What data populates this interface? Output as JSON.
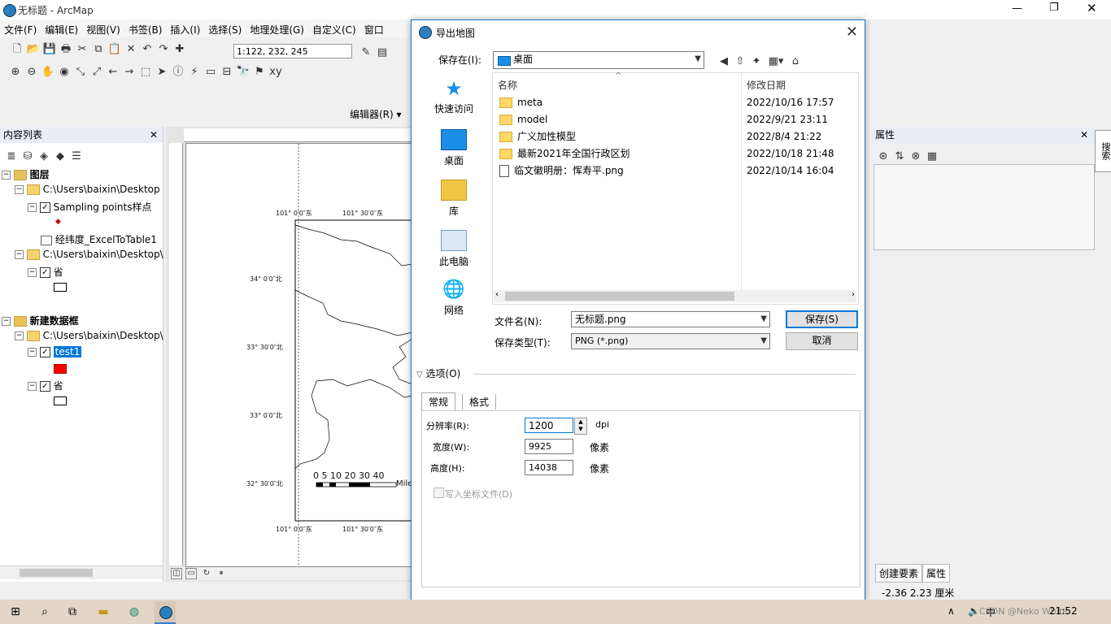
{
  "app": {
    "title": "无标题 - ArcMap",
    "menu": [
      "文件(F)",
      "编辑(E)",
      "视图(V)",
      "书签(B)",
      "插入(I)",
      "选择(S)",
      "地理处理(G)",
      "自定义(C)",
      "窗口"
    ],
    "scale": "1:122, 232, 245",
    "editor_label": "编辑器(R) ▾"
  },
  "toc": {
    "title": "内容列表",
    "layers_label": "图层",
    "path1": "C:\\Users\\baixin\\Desktop",
    "sampling": "Sampling points样点",
    "table": "经纬度_ExcelToTable1",
    "path2": "C:\\Users\\baixin\\Desktop\\",
    "sheng1": "省",
    "newframe": "新建数据框",
    "path3": "C:\\Users\\baixin\\Desktop\\",
    "test1": "test1",
    "sheng2": "省"
  },
  "map": {
    "top_lon1": "101° 0′0″东",
    "top_lon2": "101° 30′0″东",
    "bot_lon1": "101° 0′0″东",
    "bot_lon2": "101° 30′0″东",
    "lat1": "34° 0′0″北",
    "lat2": "33° 30′0″北",
    "lat3": "33° 0′0″北",
    "lat4": "32° 30′0″北",
    "scalebar": "0  5 10     20     30     40",
    "scale_unit": "Mile"
  },
  "props": {
    "title": "属性",
    "tab_create": "创建要素",
    "tab_props": "属性",
    "side_tab": "搜索"
  },
  "status": {
    "coords": "-2.36  2.23 厘米"
  },
  "dialog": {
    "title": "导出地图",
    "save_in_label": "保存在(I):",
    "save_in_value": "桌面",
    "places": [
      "快速访问",
      "桌面",
      "库",
      "此电脑",
      "网络"
    ],
    "col_name": "名称",
    "col_date": "修改日期",
    "files": [
      {
        "name": "meta",
        "date": "2022/10/16 17:57",
        "type": "folder"
      },
      {
        "name": "model",
        "date": "2022/9/21 23:11",
        "type": "folder"
      },
      {
        "name": "广义加性模型",
        "date": "2022/8/4 21:22",
        "type": "folder"
      },
      {
        "name": "最新2021年全国行政区划",
        "date": "2022/10/18 21:48",
        "type": "folder"
      },
      {
        "name": "临文徽明册：恽寿平.png",
        "date": "2022/10/14 16:04",
        "type": "file"
      }
    ],
    "filename_label": "文件名(N):",
    "filename_value": "无标题.png",
    "filetype_label": "保存类型(T):",
    "filetype_value": "PNG (*.png)",
    "save_button": "保存(S)",
    "cancel_button": "取消",
    "options_label": "选项(O)",
    "tab_general": "常规",
    "tab_format": "格式",
    "resolution_label": "分辨率(R):",
    "resolution_value": "1200",
    "resolution_unit": "dpi",
    "width_label": "宽度(W):",
    "width_value": "9925",
    "width_unit": "像素",
    "height_label": "高度(H):",
    "height_value": "14038",
    "height_unit": "像素",
    "worldfile_label": "写入坐标文件(D)"
  },
  "taskbar": {
    "time": "21:52",
    "ime": "中",
    "watermark": "CSDN @Neko White"
  }
}
